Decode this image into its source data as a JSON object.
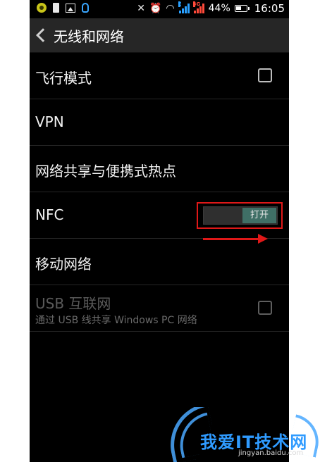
{
  "status_bar": {
    "battery_percent": "44%",
    "time": "16:05",
    "network_labels": [
      "E",
      "3G"
    ],
    "icons": [
      "android-icon",
      "sd-card-icon",
      "image-icon",
      "qq-icon",
      "mute-icon",
      "alarm-icon",
      "wifi-icon",
      "signal-icon",
      "battery-icon"
    ]
  },
  "title_bar": {
    "title": "无线和网络",
    "back_icon": "chevron-left-icon"
  },
  "settings": {
    "airplane": {
      "label": "飞行模式",
      "checked": false
    },
    "vpn": {
      "label": "VPN"
    },
    "tethering": {
      "label": "网络共享与便携式热点"
    },
    "nfc": {
      "label": "NFC",
      "toggle_label": "打开",
      "state": "on"
    },
    "mobile_network": {
      "label": "移动网络"
    },
    "usb": {
      "label": "USB 互联网",
      "sublabel": "通过 USB 线共享 Windows PC 网络",
      "checked": false,
      "disabled": true
    }
  },
  "annotation": {
    "highlight_color": "#e01818",
    "arrow_direction": "right"
  },
  "watermark": {
    "text": "我爱IT技术网",
    "sub": "jingyan.baidu.com",
    "color": "#2f9bff"
  },
  "colors": {
    "background": "#000000",
    "titlebar": "#262626",
    "toggle_on": "#3f6f66",
    "divider": "#262626"
  }
}
